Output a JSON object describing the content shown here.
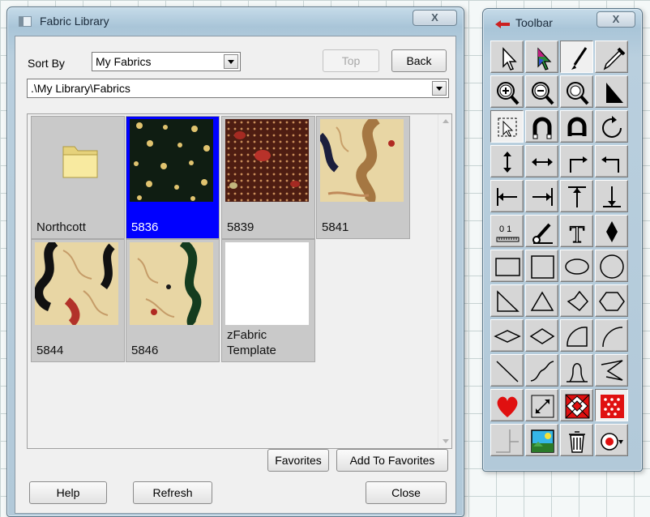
{
  "fabric_library": {
    "title": "Fabric Library",
    "close_label": "X",
    "sort_by_label": "Sort By",
    "sort_by_value": "My Fabrics",
    "top_label": "Top",
    "back_label": "Back",
    "path_value": ".\\My Library\\Fabrics",
    "items": [
      {
        "label": "Northcott",
        "type": "folder",
        "selected": false
      },
      {
        "label": "5836",
        "type": "fabric",
        "selected": true
      },
      {
        "label": "5839",
        "type": "fabric",
        "selected": false
      },
      {
        "label": "5841",
        "type": "fabric",
        "selected": false
      },
      {
        "label": "5844",
        "type": "fabric",
        "selected": false
      },
      {
        "label": "5846",
        "type": "fabric",
        "selected": false
      },
      {
        "label": "zFabric Template",
        "type": "blank",
        "selected": false
      }
    ],
    "favorites_label": "Favorites",
    "add_to_favorites_label": "Add To Favorites",
    "help_label": "Help",
    "refresh_label": "Refresh",
    "close_button_label": "Close"
  },
  "toolbar": {
    "title": "Toolbar",
    "close_label": "X",
    "tools": [
      "pointer-tool",
      "color-pointer-tool",
      "brush-tool",
      "eyedropper-tool",
      "zoom-in-tool",
      "zoom-out-tool",
      "zoom-fit-tool",
      "select-arrow-tool",
      "select-node-tool",
      "magnet-tool",
      "magnet-alt-tool",
      "rotate-tool",
      "flip-vertical-tool",
      "flip-horizontal-tool",
      "turn-right-tool",
      "turn-left-tool",
      "align-left-tool",
      "align-right-tool",
      "align-top-tool",
      "align-bottom-tool",
      "ruler-tool",
      "knife-tool",
      "text-tool",
      "diamond-tool",
      "rectangle-tool",
      "square-tool",
      "ellipse-tool",
      "circle-tool",
      "right-triangle-tool",
      "triangle-tool",
      "kite-tool",
      "hexagon-tool",
      "long-diamond-tool",
      "diamond-outline-tool",
      "quarter-arc-tool",
      "arc-tool",
      "line-tool",
      "curve-tool",
      "loop-tool",
      "zigzag-tool",
      "heart-tool",
      "resize-tool",
      "quilt-block-tool",
      "fabric-fill-tool",
      "grid-corner-tool",
      "picture-tool",
      "trash-tool",
      "fill-options-tool"
    ],
    "text_tool_glyph": "T",
    "ruler_digits": "0 1"
  }
}
